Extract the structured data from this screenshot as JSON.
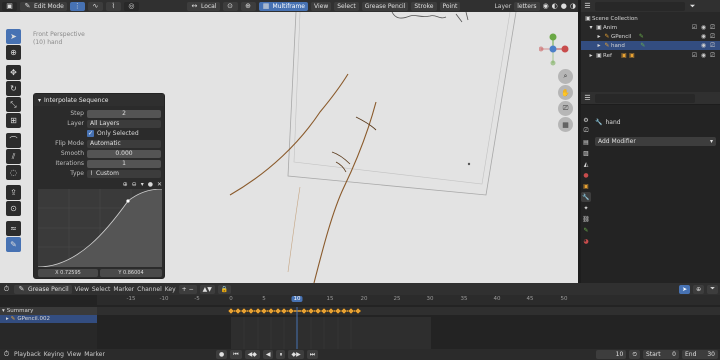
{
  "header": {
    "mode": "Edit Mode",
    "orientation": "Local",
    "multiframe": "Multiframe",
    "menus": [
      "View",
      "Select",
      "Grease Pencil",
      "Stroke",
      "Point"
    ],
    "layer_label": "Layer",
    "layer_value": "letters"
  },
  "viewport": {
    "view_name": "Front Perspective",
    "object_name": "(10) hand",
    "gizmo_axes": [
      "Z",
      "X",
      "Y"
    ]
  },
  "operator": {
    "title": "Interpolate Sequence",
    "step_label": "Step",
    "step_value": "2",
    "layer_label": "Layer",
    "layer_value": "All Layers",
    "only_selected": "Only Selected",
    "flip_label": "Flip Mode",
    "flip_value": "Automatic",
    "smooth_label": "Smooth",
    "smooth_value": "0.000",
    "iter_label": "Iterations",
    "iter_value": "1",
    "type_label": "Type",
    "type_value": "Custom",
    "curve_x": "X 0.72595",
    "curve_y": "Y 0.86004"
  },
  "outliner": {
    "items": [
      {
        "label": "Scene Collection"
      },
      {
        "label": "Anim"
      },
      {
        "label": "GPencil"
      },
      {
        "label": "hand"
      },
      {
        "label": "Ref"
      }
    ]
  },
  "properties": {
    "object": "hand",
    "add_modifier": "Add Modifier"
  },
  "timeline": {
    "editor": "Grease Pencil",
    "menus": [
      "View",
      "Select",
      "Marker",
      "Channel",
      "Key"
    ],
    "ticks": [
      "-15",
      "-10",
      "-5",
      "0",
      "5",
      "10",
      "15",
      "20",
      "25",
      "30",
      "35",
      "40",
      "45",
      "50"
    ],
    "current_frame": "10",
    "channels": [
      "Summary",
      "GPencil.002"
    ],
    "footer_menus": [
      "Playback",
      "Keying",
      "View",
      "Marker"
    ],
    "frame": "10",
    "start_label": "Start",
    "start_value": "0",
    "end_label": "End",
    "end_value": "30"
  },
  "colors": {
    "accent": "#4772b3",
    "stroke": "#8a5a2b",
    "keyframe": "#e8a233"
  }
}
